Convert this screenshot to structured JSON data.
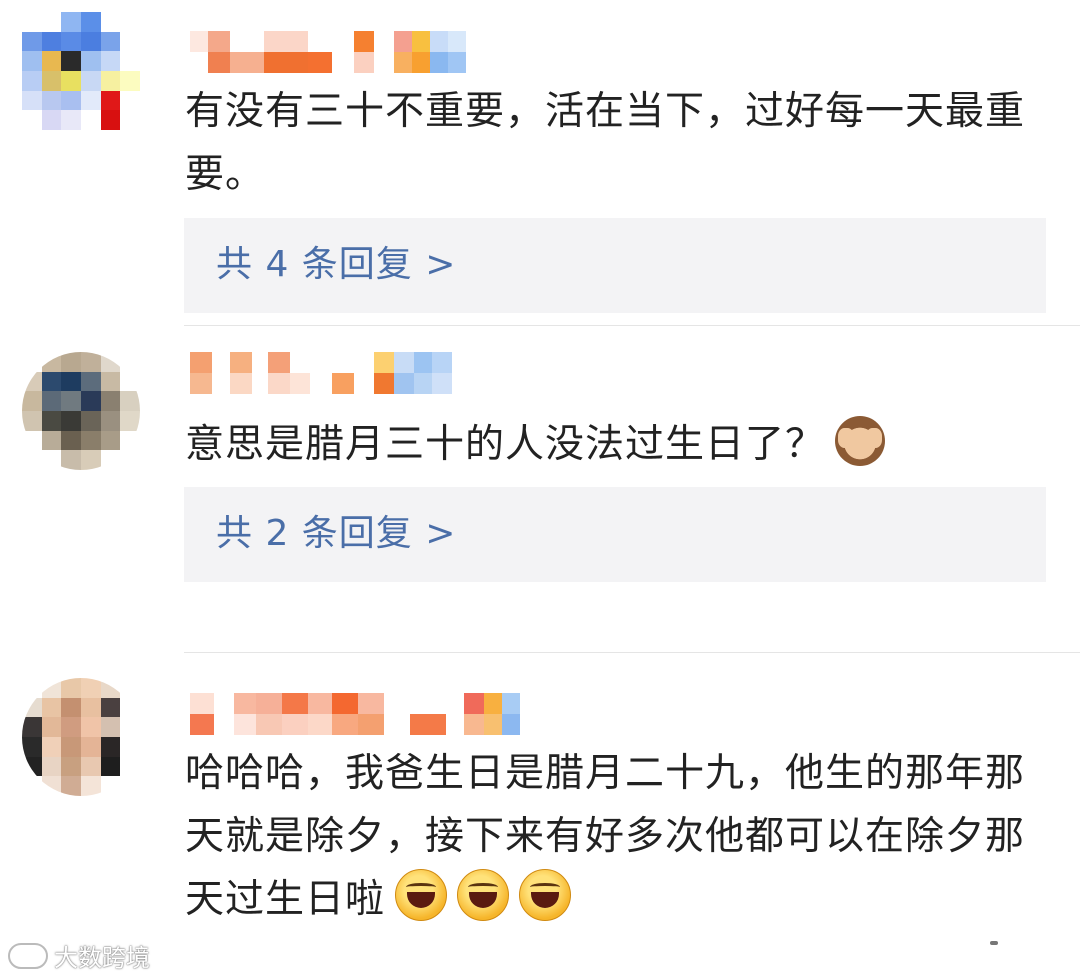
{
  "comments": [
    {
      "text": "有没有三十不重要，活在当下，过好每一天最重要。",
      "reply_link": "共 4 条回复 >"
    },
    {
      "text": "意思是腊月三十的人没法过生日了？",
      "emoji": "see-no-evil-monkey",
      "reply_link": "共 2 条回复 >"
    },
    {
      "text": "哈哈哈，我爸生日是腊月二十九，他生的那年那天就是除夕，接下来有好多次他都可以在除夕那天过生日啦",
      "emoji": "laughing-face"
    }
  ],
  "watermark": {
    "text": "大数跨境"
  },
  "colors": {
    "reply_link": "#4a6ea8",
    "reply_bg": "#f3f3f5",
    "text": "#222222",
    "divider": "#e5e5e5"
  }
}
